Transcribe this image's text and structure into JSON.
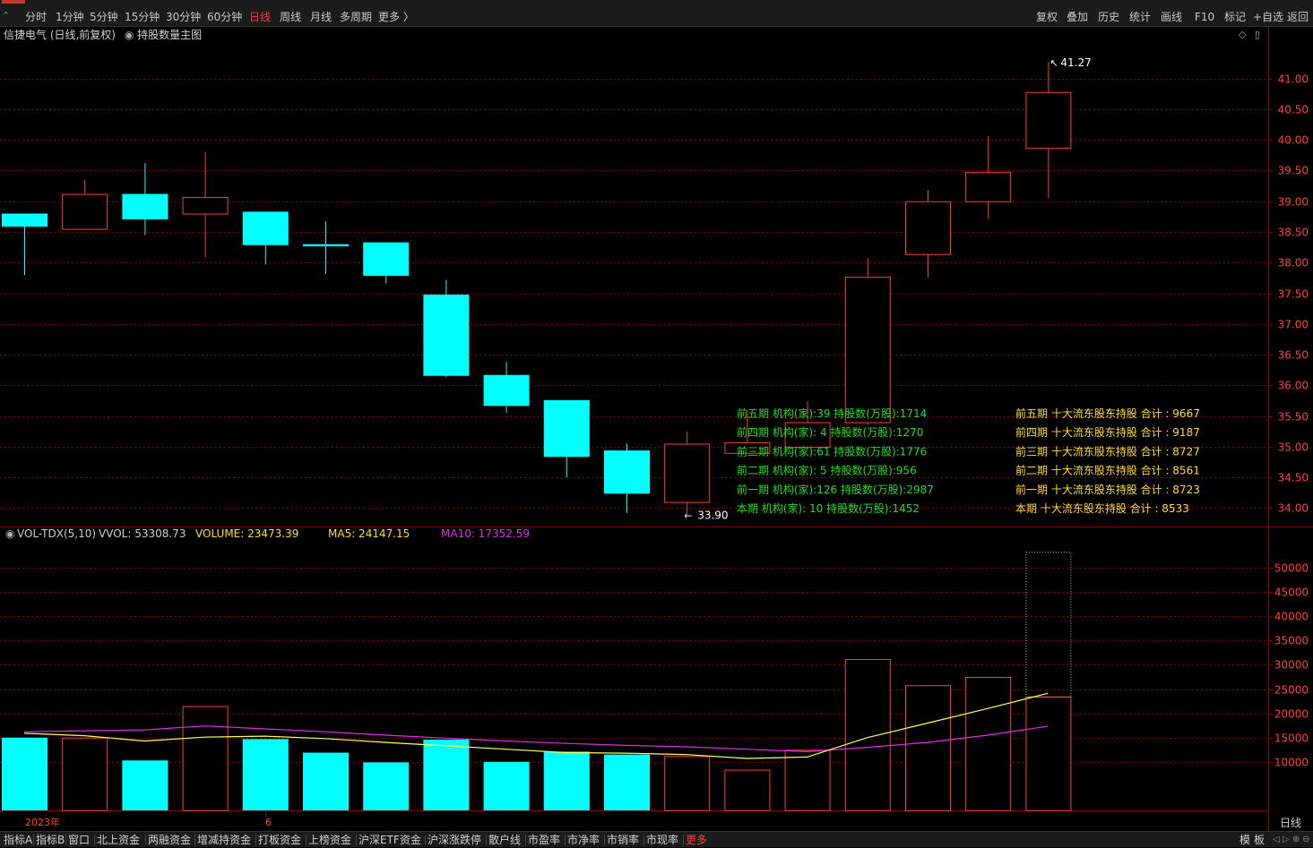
{
  "top_bar": {
    "periods": [
      "分时",
      "1分钟",
      "5分钟",
      "15分钟",
      "30分钟",
      "60分钟",
      "日线",
      "周线",
      "月线",
      "多周期",
      "更多 〉"
    ],
    "active_period": "日线",
    "right_buttons": [
      "复权",
      "叠加",
      "历史",
      "统计",
      "画线",
      "F10",
      "标记",
      "+自选",
      "返回"
    ]
  },
  "chart_header": {
    "title": "信捷电气 (日线,前复权)",
    "indicator": "持股数量主图"
  },
  "colors": {
    "up": "#ff3c3c",
    "down": "#00ffff",
    "grid": "#8b0000",
    "axis_text": "#ff4040",
    "ma5": "#ffff50",
    "ma10": "#e030e0",
    "green_text": "#22dd22",
    "yellow_text": "#ffdd33"
  },
  "chart_data": [
    {
      "type": "candlestick",
      "title": "信捷电气 (日线,前复权)",
      "ylim": [
        33.7,
        41.55
      ],
      "y_ticks": [
        34.0,
        34.5,
        35.0,
        35.5,
        36.0,
        36.5,
        37.0,
        37.5,
        38.0,
        38.5,
        39.0,
        39.5,
        40.0,
        40.5,
        41.0
      ],
      "x_labels": [
        "2023年",
        "6"
      ],
      "candles": [
        {
          "o": 38.8,
          "h": 38.8,
          "l": 37.8,
          "c": 38.6
        },
        {
          "o": 38.55,
          "h": 39.35,
          "l": 38.55,
          "c": 39.12
        },
        {
          "o": 39.12,
          "h": 39.62,
          "l": 38.45,
          "c": 38.72
        },
        {
          "o": 38.8,
          "h": 39.8,
          "l": 38.08,
          "c": 39.07
        },
        {
          "o": 38.83,
          "h": 38.83,
          "l": 37.97,
          "c": 38.3
        },
        {
          "o": 38.3,
          "h": 38.67,
          "l": 37.82,
          "c": 38.28
        },
        {
          "o": 38.33,
          "h": 38.33,
          "l": 37.66,
          "c": 37.8
        },
        {
          "o": 37.48,
          "h": 37.72,
          "l": 36.13,
          "c": 36.17
        },
        {
          "o": 36.17,
          "h": 36.38,
          "l": 35.55,
          "c": 35.68
        },
        {
          "o": 35.76,
          "h": 35.76,
          "l": 34.5,
          "c": 34.85
        },
        {
          "o": 34.94,
          "h": 35.05,
          "l": 33.92,
          "c": 34.25
        },
        {
          "o": 34.1,
          "h": 35.25,
          "l": 33.9,
          "c": 35.05
        },
        {
          "o": 34.9,
          "h": 35.6,
          "l": 34.9,
          "c": 35.07
        },
        {
          "o": 35.0,
          "h": 35.74,
          "l": 34.95,
          "c": 35.4
        },
        {
          "o": 35.4,
          "h": 38.07,
          "l": 35.35,
          "c": 37.77
        },
        {
          "o": 38.14,
          "h": 39.18,
          "l": 37.76,
          "c": 39.0
        },
        {
          "o": 39.0,
          "h": 40.06,
          "l": 38.71,
          "c": 39.48
        },
        {
          "o": 39.87,
          "h": 41.27,
          "l": 39.05,
          "c": 40.78
        }
      ],
      "high_label": "41.27",
      "low_label": "33.90"
    },
    {
      "type": "bar",
      "title": "VOL-TDX(5,10)",
      "ylim": [
        0,
        55000
      ],
      "y_ticks": [
        10000,
        15000,
        20000,
        25000,
        30000,
        35000,
        40000,
        45000,
        50000
      ],
      "volumes": [
        15000,
        15000,
        10300,
        21500,
        14700,
        11900,
        9900,
        14600,
        10000,
        12100,
        11500,
        11200,
        8400,
        12500,
        31200,
        25800,
        27500,
        23473.39
      ],
      "vvol": 53308.73,
      "ma5": [
        15900,
        15400,
        14300,
        15100,
        15300,
        14800,
        14000,
        13300,
        12600,
        11900,
        11800,
        11500,
        10700,
        11000,
        15000,
        18000,
        21000,
        24147.15
      ],
      "ma10": [
        16200,
        16400,
        16600,
        17400,
        16800,
        16200,
        15500,
        14900,
        14300,
        13800,
        13400,
        13100,
        12600,
        12100,
        13000,
        14000,
        15500,
        17352.59
      ],
      "vvol_label": "VVOL: 53308.73",
      "volume_label": "VOLUME: 23473.39",
      "ma5_label": "MA5: 24147.15",
      "ma10_label": "MA10: 17352.59"
    }
  ],
  "holdings": {
    "institutions": [
      "前五期 机构(家):39 持股数(万股):1714",
      "前四期 机构(家): 4 持股数(万股):1270",
      "前三期 机构(家):61 持股数(万股):1776",
      "前二期 机构(家): 5 持股数(万股):956",
      "前一期 机构(家):126 持股数(万股):2987",
      "本期 机构(家): 10 持股数(万股):1452"
    ],
    "top_holders": [
      "前五期 十大流东股东持股 合计 : 9667",
      "前四期 十大流东股东持股 合计 : 9187",
      "前三期 十大流东股东持股 合计 : 8727",
      "前二期 十大流东股东持股 合计 : 8561",
      "前一期 十大流东股东持股 合计 : 8723",
      "本期 十大流东股东持股 合计 : 8533"
    ]
  },
  "right_axis_bottom_label": "日线",
  "bottom_bar": {
    "tabs": [
      "指标A",
      "指标B",
      "窗口",
      "北上资金",
      "两融资金",
      "增减持资金",
      "打板资金",
      "上榜资金",
      "沪深ETF资金",
      "沪深涨跌停",
      "散户线",
      "市盈率",
      "市净率",
      "市销率",
      "市现率",
      "更多"
    ],
    "right_items": [
      "模",
      "板"
    ]
  }
}
